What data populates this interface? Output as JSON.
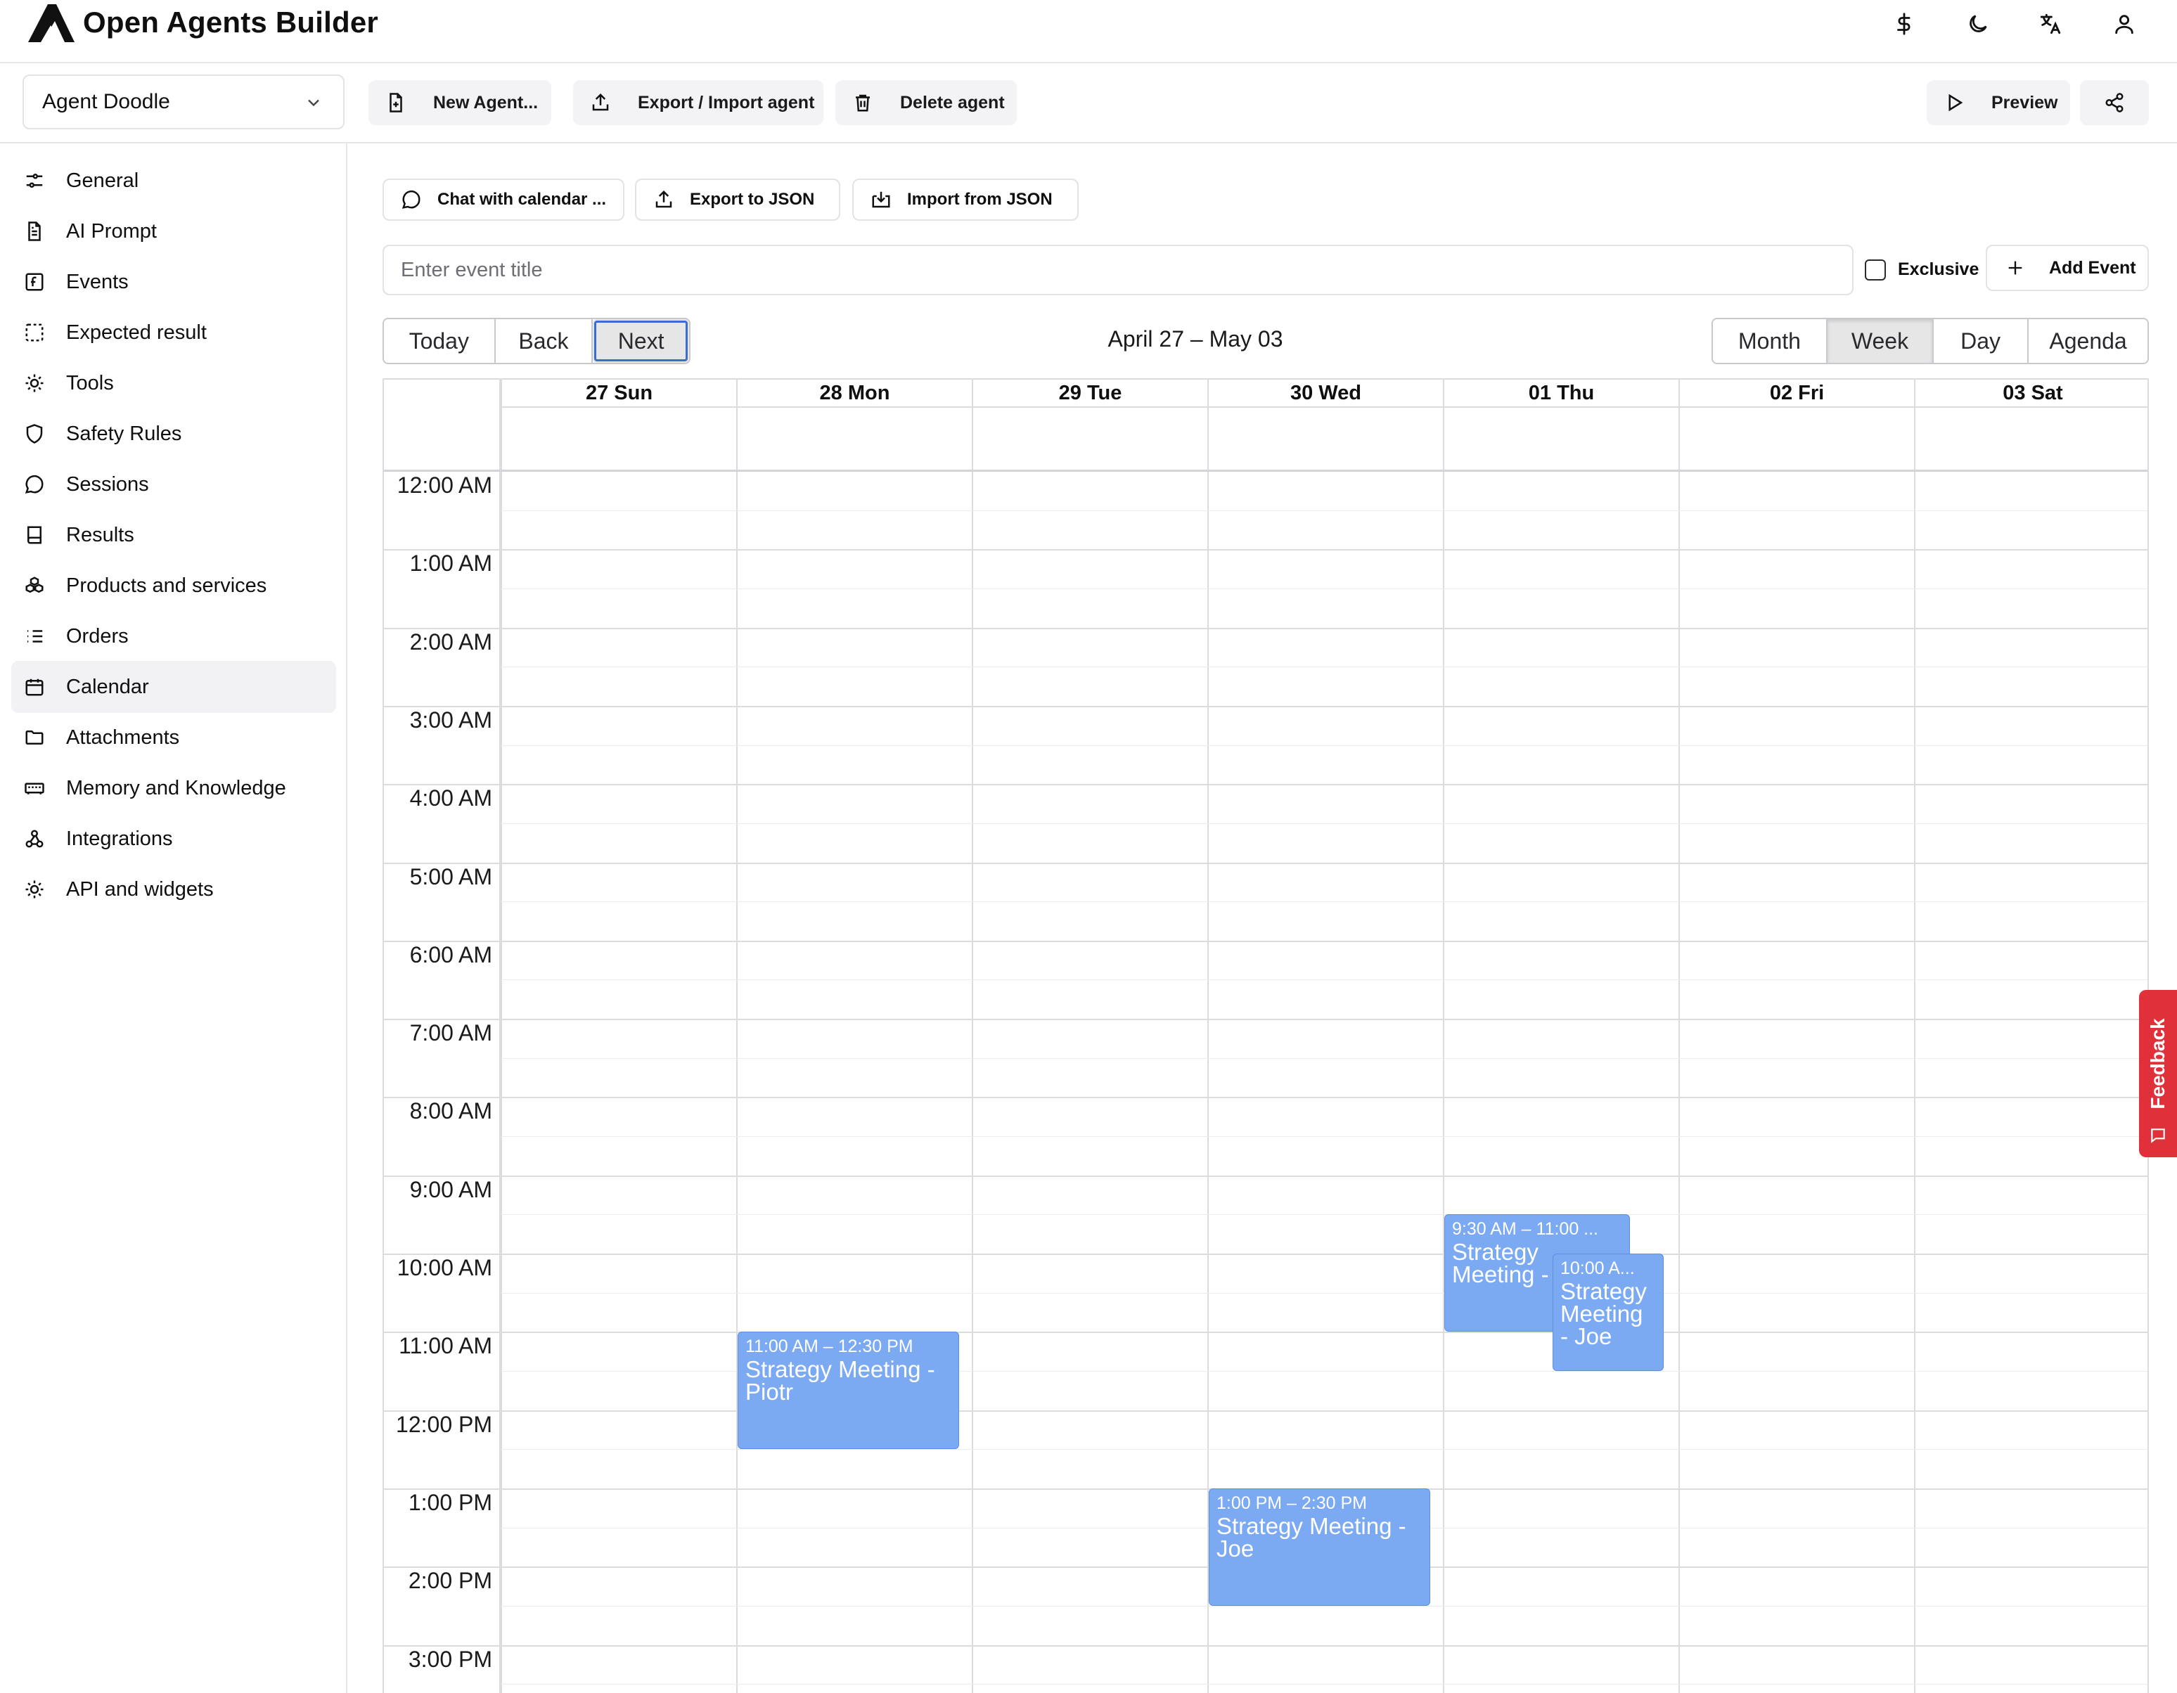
{
  "app": {
    "title": "Open Agents Builder"
  },
  "header_icons": [
    "dollar-icon",
    "moon-icon",
    "translate-icon",
    "user-icon"
  ],
  "toolbar": {
    "agent_name": "Agent Doodle",
    "new_agent": "New Agent...",
    "export_import": "Export / Import agent",
    "delete_agent": "Delete agent",
    "preview": "Preview"
  },
  "sidebar": {
    "items": [
      {
        "label": "General",
        "icon": "sliders-icon"
      },
      {
        "label": "AI Prompt",
        "icon": "document-icon"
      },
      {
        "label": "Events",
        "icon": "function-icon"
      },
      {
        "label": "Expected result",
        "icon": "dashed-square-icon"
      },
      {
        "label": "Tools",
        "icon": "cog-icon"
      },
      {
        "label": "Safety Rules",
        "icon": "shield-icon"
      },
      {
        "label": "Sessions",
        "icon": "chat-bubble-icon"
      },
      {
        "label": "Results",
        "icon": "book-icon"
      },
      {
        "label": "Products and services",
        "icon": "boxes-icon"
      },
      {
        "label": "Orders",
        "icon": "list-icon"
      },
      {
        "label": "Calendar",
        "icon": "calendar-icon"
      },
      {
        "label": "Attachments",
        "icon": "folder-icon"
      },
      {
        "label": "Memory and Knowledge",
        "icon": "memory-icon"
      },
      {
        "label": "Integrations",
        "icon": "webhook-icon"
      },
      {
        "label": "API and widgets",
        "icon": "cog-icon"
      }
    ],
    "active": "Calendar"
  },
  "actions": {
    "chat": "Chat with calendar ...",
    "export_json": "Export to JSON",
    "import_json": "Import from JSON"
  },
  "event_form": {
    "placeholder": "Enter event title",
    "value": "",
    "exclusive_label": "Exclusive",
    "exclusive_checked": false,
    "add_label": "Add Event"
  },
  "nav": {
    "today": "Today",
    "back": "Back",
    "next": "Next",
    "range": "April 27 – May 03"
  },
  "views": {
    "month": "Month",
    "week": "Week",
    "day": "Day",
    "agenda": "Agenda",
    "selected": "Week"
  },
  "calendar": {
    "days": [
      "27 Sun",
      "28 Mon",
      "29 Tue",
      "30 Wed",
      "01 Thu",
      "02 Fri",
      "03 Sat"
    ],
    "hours": [
      "12:00 AM",
      "1:00 AM",
      "2:00 AM",
      "3:00 AM",
      "4:00 AM",
      "5:00 AM",
      "6:00 AM",
      "7:00 AM",
      "8:00 AM",
      "9:00 AM",
      "10:00 AM",
      "11:00 AM",
      "12:00 PM",
      "1:00 PM",
      "2:00 PM",
      "3:00 PM"
    ],
    "events": [
      {
        "day": "28 Mon",
        "start": "11:00 AM",
        "end": "12:30 PM",
        "time_text": "11:00 AM – 12:30 PM",
        "title": "Strategy Meeting - Piotr"
      },
      {
        "day": "30 Wed",
        "start": "1:00 PM",
        "end": "2:30 PM",
        "time_text": "1:00 PM – 2:30 PM",
        "title": "Strategy Meeting - Joe"
      },
      {
        "day": "01 Thu",
        "start": "9:30 AM",
        "end": "11:00 AM",
        "time_text": "9:30 AM – 11:00 ...",
        "title": "Strategy Meeting - Joe"
      },
      {
        "day": "01 Thu",
        "start": "10:00 AM",
        "end": "11:30 AM",
        "time_text": "10:00 A...",
        "title": "Strategy Meeting - Joe"
      }
    ]
  },
  "feedback": {
    "label": "Feedback"
  },
  "colors": {
    "event": "#7ba9f2",
    "feedback": "#e0303a",
    "active_nav": "#f2f2f4"
  }
}
